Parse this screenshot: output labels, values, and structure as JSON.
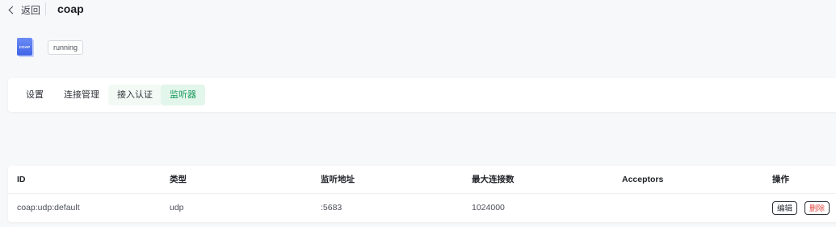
{
  "header": {
    "back_label": "返回",
    "title": "coap"
  },
  "app": {
    "icon_text": "COAP",
    "status": "running",
    "icon_color": "#4f72ee"
  },
  "tabs": [
    {
      "label": "设置",
      "state": "normal"
    },
    {
      "label": "连接管理",
      "state": "normal"
    },
    {
      "label": "接入认证",
      "state": "hover"
    },
    {
      "label": "监听器",
      "state": "active"
    }
  ],
  "colors": {
    "active_tab_bg": "#e3f6ec",
    "active_tab_text": "#1a9a5c",
    "delete_text": "#e0463f"
  },
  "table": {
    "columns": [
      "ID",
      "类型",
      "监听地址",
      "最大连接数",
      "Acceptors",
      "操作"
    ],
    "rows": [
      {
        "id": "coap:udp:default",
        "type": "udp",
        "address": ":5683",
        "max_connections": "1024000",
        "acceptors": "",
        "actions": {
          "edit": "编辑",
          "delete": "删除"
        }
      }
    ]
  }
}
